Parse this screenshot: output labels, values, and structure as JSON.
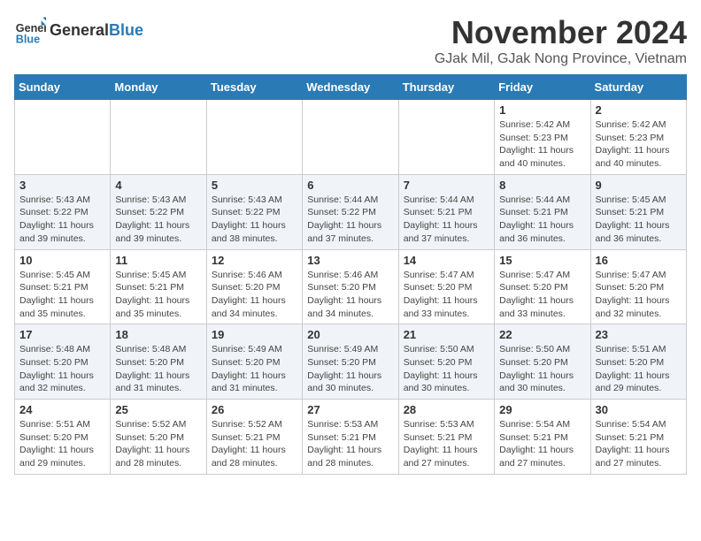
{
  "header": {
    "logo_general": "General",
    "logo_blue": "Blue",
    "month_title": "November 2024",
    "location": "GJak Mil, GJak Nong Province, Vietnam"
  },
  "weekdays": [
    "Sunday",
    "Monday",
    "Tuesday",
    "Wednesday",
    "Thursday",
    "Friday",
    "Saturday"
  ],
  "weeks": [
    [
      {
        "day": "",
        "info": ""
      },
      {
        "day": "",
        "info": ""
      },
      {
        "day": "",
        "info": ""
      },
      {
        "day": "",
        "info": ""
      },
      {
        "day": "",
        "info": ""
      },
      {
        "day": "1",
        "info": "Sunrise: 5:42 AM\nSunset: 5:23 PM\nDaylight: 11 hours and 40 minutes."
      },
      {
        "day": "2",
        "info": "Sunrise: 5:42 AM\nSunset: 5:23 PM\nDaylight: 11 hours and 40 minutes."
      }
    ],
    [
      {
        "day": "3",
        "info": "Sunrise: 5:43 AM\nSunset: 5:22 PM\nDaylight: 11 hours and 39 minutes."
      },
      {
        "day": "4",
        "info": "Sunrise: 5:43 AM\nSunset: 5:22 PM\nDaylight: 11 hours and 39 minutes."
      },
      {
        "day": "5",
        "info": "Sunrise: 5:43 AM\nSunset: 5:22 PM\nDaylight: 11 hours and 38 minutes."
      },
      {
        "day": "6",
        "info": "Sunrise: 5:44 AM\nSunset: 5:22 PM\nDaylight: 11 hours and 37 minutes."
      },
      {
        "day": "7",
        "info": "Sunrise: 5:44 AM\nSunset: 5:21 PM\nDaylight: 11 hours and 37 minutes."
      },
      {
        "day": "8",
        "info": "Sunrise: 5:44 AM\nSunset: 5:21 PM\nDaylight: 11 hours and 36 minutes."
      },
      {
        "day": "9",
        "info": "Sunrise: 5:45 AM\nSunset: 5:21 PM\nDaylight: 11 hours and 36 minutes."
      }
    ],
    [
      {
        "day": "10",
        "info": "Sunrise: 5:45 AM\nSunset: 5:21 PM\nDaylight: 11 hours and 35 minutes."
      },
      {
        "day": "11",
        "info": "Sunrise: 5:45 AM\nSunset: 5:21 PM\nDaylight: 11 hours and 35 minutes."
      },
      {
        "day": "12",
        "info": "Sunrise: 5:46 AM\nSunset: 5:20 PM\nDaylight: 11 hours and 34 minutes."
      },
      {
        "day": "13",
        "info": "Sunrise: 5:46 AM\nSunset: 5:20 PM\nDaylight: 11 hours and 34 minutes."
      },
      {
        "day": "14",
        "info": "Sunrise: 5:47 AM\nSunset: 5:20 PM\nDaylight: 11 hours and 33 minutes."
      },
      {
        "day": "15",
        "info": "Sunrise: 5:47 AM\nSunset: 5:20 PM\nDaylight: 11 hours and 33 minutes."
      },
      {
        "day": "16",
        "info": "Sunrise: 5:47 AM\nSunset: 5:20 PM\nDaylight: 11 hours and 32 minutes."
      }
    ],
    [
      {
        "day": "17",
        "info": "Sunrise: 5:48 AM\nSunset: 5:20 PM\nDaylight: 11 hours and 32 minutes."
      },
      {
        "day": "18",
        "info": "Sunrise: 5:48 AM\nSunset: 5:20 PM\nDaylight: 11 hours and 31 minutes."
      },
      {
        "day": "19",
        "info": "Sunrise: 5:49 AM\nSunset: 5:20 PM\nDaylight: 11 hours and 31 minutes."
      },
      {
        "day": "20",
        "info": "Sunrise: 5:49 AM\nSunset: 5:20 PM\nDaylight: 11 hours and 30 minutes."
      },
      {
        "day": "21",
        "info": "Sunrise: 5:50 AM\nSunset: 5:20 PM\nDaylight: 11 hours and 30 minutes."
      },
      {
        "day": "22",
        "info": "Sunrise: 5:50 AM\nSunset: 5:20 PM\nDaylight: 11 hours and 30 minutes."
      },
      {
        "day": "23",
        "info": "Sunrise: 5:51 AM\nSunset: 5:20 PM\nDaylight: 11 hours and 29 minutes."
      }
    ],
    [
      {
        "day": "24",
        "info": "Sunrise: 5:51 AM\nSunset: 5:20 PM\nDaylight: 11 hours and 29 minutes."
      },
      {
        "day": "25",
        "info": "Sunrise: 5:52 AM\nSunset: 5:20 PM\nDaylight: 11 hours and 28 minutes."
      },
      {
        "day": "26",
        "info": "Sunrise: 5:52 AM\nSunset: 5:21 PM\nDaylight: 11 hours and 28 minutes."
      },
      {
        "day": "27",
        "info": "Sunrise: 5:53 AM\nSunset: 5:21 PM\nDaylight: 11 hours and 28 minutes."
      },
      {
        "day": "28",
        "info": "Sunrise: 5:53 AM\nSunset: 5:21 PM\nDaylight: 11 hours and 27 minutes."
      },
      {
        "day": "29",
        "info": "Sunrise: 5:54 AM\nSunset: 5:21 PM\nDaylight: 11 hours and 27 minutes."
      },
      {
        "day": "30",
        "info": "Sunrise: 5:54 AM\nSunset: 5:21 PM\nDaylight: 11 hours and 27 minutes."
      }
    ]
  ]
}
